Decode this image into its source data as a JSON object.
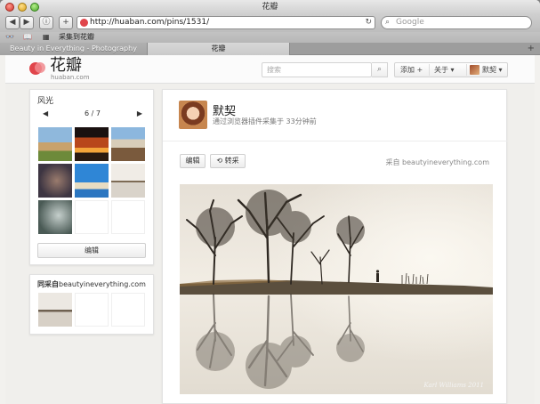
{
  "window": {
    "title": "花瓣"
  },
  "toolbar": {
    "back": "◀",
    "forward": "▶",
    "reader": "ⓘ",
    "add": "+",
    "url": "http://huaban.com/pins/1531/",
    "reload": "↻",
    "search_placeholder": "Google"
  },
  "bookmarks": {
    "items": [
      "采集到花瓣"
    ]
  },
  "tabs": [
    {
      "label": "Beauty in Everything - Photography"
    },
    {
      "label": "花瓣"
    }
  ],
  "site": {
    "logo_cn": "花瓣",
    "logo_en": "huaban.com",
    "search_placeholder": "搜索",
    "nav": {
      "add": "添加",
      "about": "关于",
      "user": "默契"
    }
  },
  "board": {
    "title": "风光",
    "pager": "6 / 7",
    "edit_label": "编辑"
  },
  "source_panel": {
    "prefix": "同采自",
    "domain": "beautyineverything.com"
  },
  "pin": {
    "user": "默契",
    "meta": "通过浏览器插件采集于 33分钟前",
    "edit_label": "编辑",
    "repin_label": "转采",
    "source_prefix": "采自",
    "source_domain": "beautyineverything.com",
    "watermark": "Karl Williams 2011"
  },
  "colors": {
    "brand": "#e0454b"
  }
}
